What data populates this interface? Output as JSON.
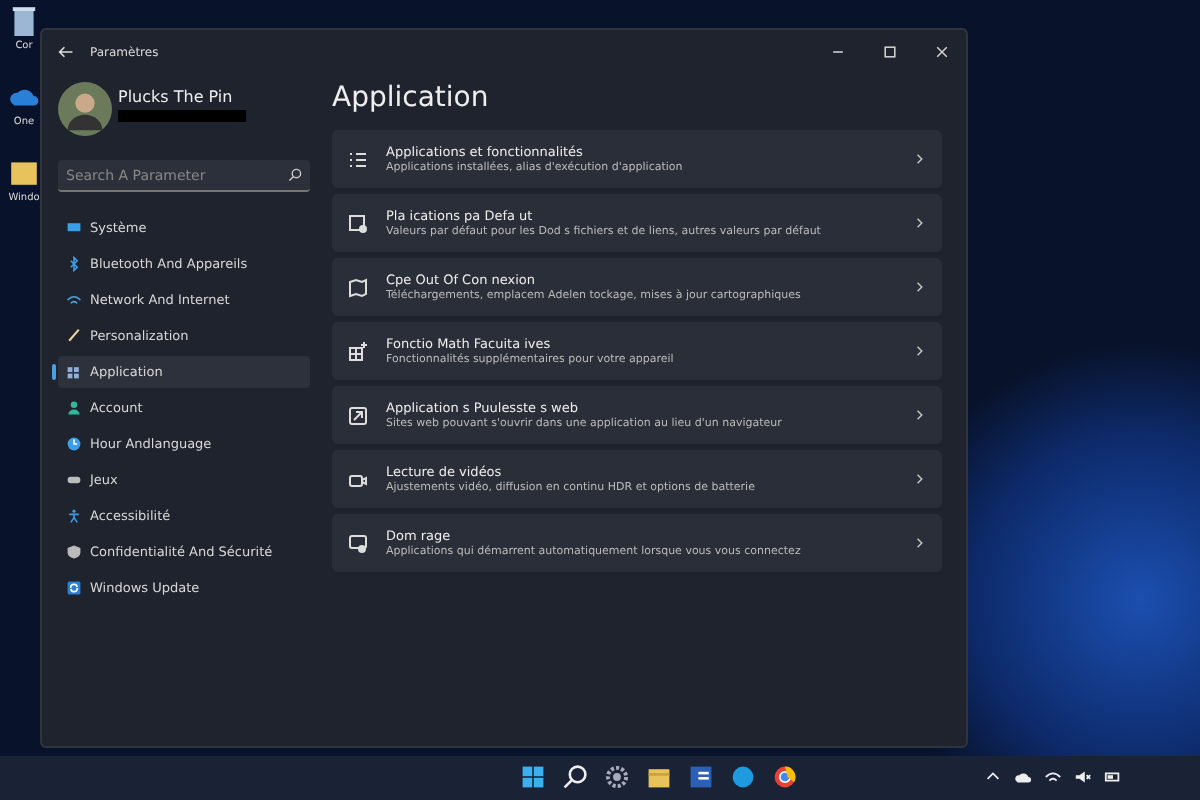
{
  "desktop": {
    "icons": [
      {
        "label": "Cor"
      },
      {
        "label": "One"
      },
      {
        "label": "Windo"
      }
    ]
  },
  "window": {
    "title": "Paramètres"
  },
  "profile": {
    "name": "Plucks The Pin"
  },
  "search": {
    "placeholder": "Search A Parameter"
  },
  "sidebar": {
    "items": [
      {
        "label": "Système",
        "selected": false
      },
      {
        "label": "Bluetooth And Appareils",
        "selected": false
      },
      {
        "label": "Network And Internet",
        "selected": false
      },
      {
        "label": "Personalization",
        "selected": false
      },
      {
        "label": "Application",
        "selected": true
      },
      {
        "label": "Account",
        "selected": false
      },
      {
        "label": "Hour Andlanguage",
        "selected": false
      },
      {
        "label": "Jeux",
        "selected": false
      },
      {
        "label": "Accessibilité",
        "selected": false
      },
      {
        "label": "Confidentialité And Sécurité",
        "selected": false
      },
      {
        "label": "Windows Update",
        "selected": false
      }
    ]
  },
  "page": {
    "heading": "Application",
    "cards": [
      {
        "title": "Applications et fonctionnalités",
        "description": "Applications installées, alias d'exécution d'application"
      },
      {
        "title": "Pla ications pa Defa ut",
        "description": "Valeurs par défaut pour les Dod s fichiers et de liens, autres valeurs par défaut"
      },
      {
        "title": "Cpe Out Of Con nexion",
        "description": "Téléchargements, emplacem Adelen tockage, mises à jour cartographiques"
      },
      {
        "title": "Fonctio Math Facuita ives",
        "description": "Fonctionnalités supplémentaires pour votre appareil"
      },
      {
        "title": "Application s Puulesste s web",
        "description": "Sites web pouvant s'ouvrir dans une application au lieu d'un navigateur"
      },
      {
        "title": "Lecture de vidéos",
        "description": "Ajustements vidéo, diffusion en continu HDR et options de batterie"
      },
      {
        "title": "Dom rage",
        "description": "Applications qui démarrent automatiquement lorsque vous vous connectez"
      }
    ]
  }
}
